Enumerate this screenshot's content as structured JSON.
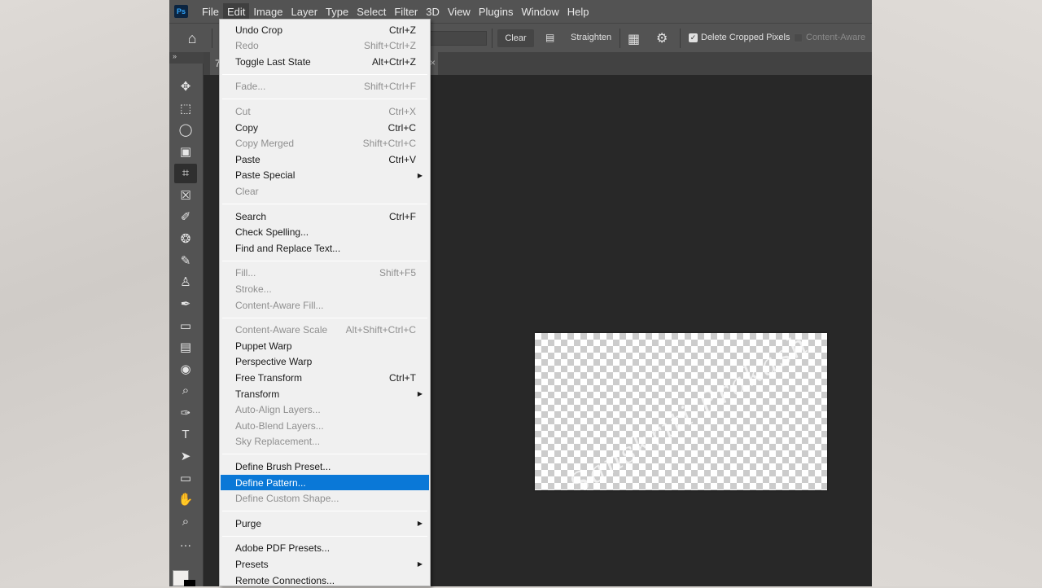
{
  "app": {
    "logo": "Ps",
    "menubar": [
      "File",
      "Edit",
      "Image",
      "Layer",
      "Type",
      "Select",
      "Filter",
      "3D",
      "View",
      "Plugins",
      "Window",
      "Help"
    ],
    "active_menu": "Edit"
  },
  "options_bar": {
    "home_icon": "home-icon",
    "clear_label": "Clear",
    "straighten_label": "Straighten",
    "delete_cropped_label": "Delete Cropped Pixels",
    "delete_cropped_checked": true,
    "content_aware_label": "Content-Aware",
    "content_aware_checked": false
  },
  "document": {
    "tab_label": "7",
    "watermark_text": "Sanskriti Prakash"
  },
  "tools": [
    "move",
    "marquee",
    "lasso",
    "object-selection",
    "crop",
    "frame",
    "eyedropper",
    "healing-brush",
    "brush",
    "clone-stamp",
    "history-brush",
    "eraser",
    "gradient",
    "blur",
    "dodge",
    "pen",
    "type",
    "path-selection",
    "rectangle",
    "hand",
    "zoom",
    "more"
  ],
  "active_tool": "crop",
  "edit_menu": [
    {
      "label": "Undo Crop",
      "shortcut": "Ctrl+Z",
      "enabled": true
    },
    {
      "label": "Redo",
      "shortcut": "Shift+Ctrl+Z",
      "enabled": false
    },
    {
      "label": "Toggle Last State",
      "shortcut": "Alt+Ctrl+Z",
      "enabled": true
    },
    {
      "sep": true
    },
    {
      "label": "Fade...",
      "shortcut": "Shift+Ctrl+F",
      "enabled": false
    },
    {
      "sep": true
    },
    {
      "label": "Cut",
      "shortcut": "Ctrl+X",
      "enabled": false
    },
    {
      "label": "Copy",
      "shortcut": "Ctrl+C",
      "enabled": true
    },
    {
      "label": "Copy Merged",
      "shortcut": "Shift+Ctrl+C",
      "enabled": false
    },
    {
      "label": "Paste",
      "shortcut": "Ctrl+V",
      "enabled": true
    },
    {
      "label": "Paste Special",
      "shortcut": "",
      "enabled": true,
      "submenu": true
    },
    {
      "label": "Clear",
      "shortcut": "",
      "enabled": false
    },
    {
      "sep": true
    },
    {
      "label": "Search",
      "shortcut": "Ctrl+F",
      "enabled": true
    },
    {
      "label": "Check Spelling...",
      "shortcut": "",
      "enabled": true
    },
    {
      "label": "Find and Replace Text...",
      "shortcut": "",
      "enabled": true
    },
    {
      "sep": true
    },
    {
      "label": "Fill...",
      "shortcut": "Shift+F5",
      "enabled": false
    },
    {
      "label": "Stroke...",
      "shortcut": "",
      "enabled": false
    },
    {
      "label": "Content-Aware Fill...",
      "shortcut": "",
      "enabled": false
    },
    {
      "sep": true
    },
    {
      "label": "Content-Aware Scale",
      "shortcut": "Alt+Shift+Ctrl+C",
      "enabled": false
    },
    {
      "label": "Puppet Warp",
      "shortcut": "",
      "enabled": true
    },
    {
      "label": "Perspective Warp",
      "shortcut": "",
      "enabled": true
    },
    {
      "label": "Free Transform",
      "shortcut": "Ctrl+T",
      "enabled": true
    },
    {
      "label": "Transform",
      "shortcut": "",
      "enabled": true,
      "submenu": true
    },
    {
      "label": "Auto-Align Layers...",
      "shortcut": "",
      "enabled": false
    },
    {
      "label": "Auto-Blend Layers...",
      "shortcut": "",
      "enabled": false
    },
    {
      "label": "Sky Replacement...",
      "shortcut": "",
      "enabled": false
    },
    {
      "sep": true
    },
    {
      "label": "Define Brush Preset...",
      "shortcut": "",
      "enabled": true
    },
    {
      "label": "Define Pattern...",
      "shortcut": "",
      "enabled": true,
      "selected": true
    },
    {
      "label": "Define Custom Shape...",
      "shortcut": "",
      "enabled": false
    },
    {
      "sep": true
    },
    {
      "label": "Purge",
      "shortcut": "",
      "enabled": true,
      "submenu": true
    },
    {
      "sep": true
    },
    {
      "label": "Adobe PDF Presets...",
      "shortcut": "",
      "enabled": true
    },
    {
      "label": "Presets",
      "shortcut": "",
      "enabled": true,
      "submenu": true
    },
    {
      "label": "Remote Connections...",
      "shortcut": "",
      "enabled": true
    }
  ],
  "colors": {
    "selected_highlight": "#0a78d7",
    "menu_bg": "#f0f0f0",
    "app_chrome": "#535353",
    "canvas_bg": "#282828"
  }
}
